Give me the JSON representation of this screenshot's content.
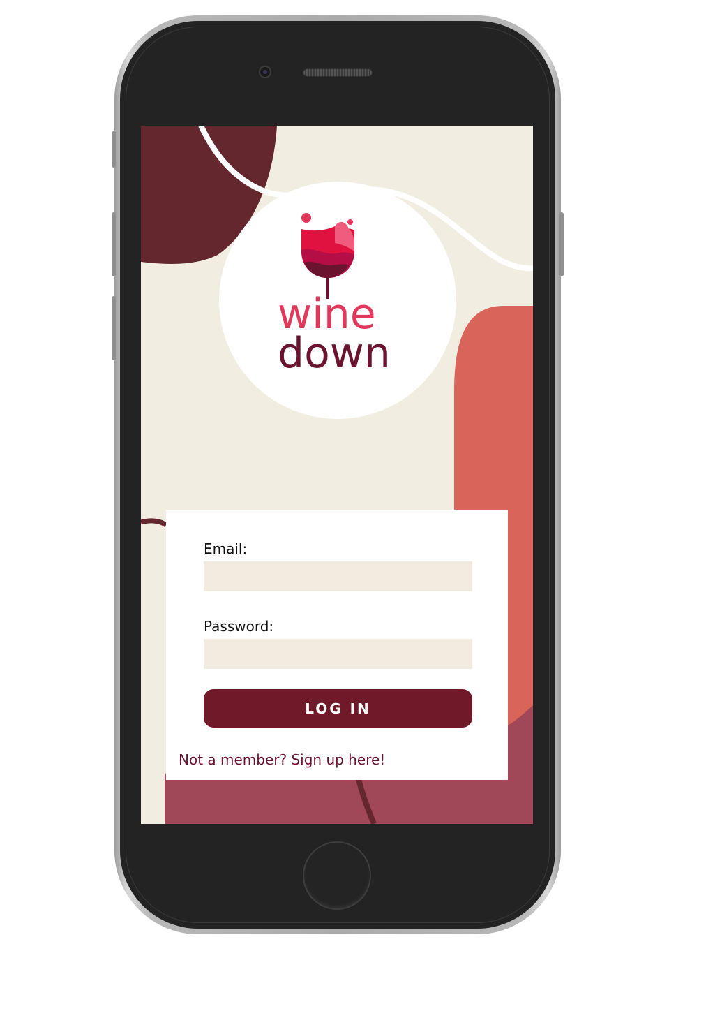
{
  "app": {
    "brand_line1": "wine",
    "brand_line2": "down"
  },
  "login_form": {
    "email_label": "Email:",
    "email_value": "",
    "password_label": "Password:",
    "password_value": "",
    "login_button_label": "LOG IN",
    "signup_link_text": "Not a member? Sign up here!"
  },
  "colors": {
    "background_cream": "#f2ede1",
    "dark_maroon": "#63272d",
    "coral": "#d9655a",
    "mauve": "#a04857",
    "button_maroon": "#701a29",
    "brand_pink": "#e2385c",
    "brand_wine": "#6b1430",
    "input_fill": "#f2ebe0"
  },
  "icons": {
    "logo": "wine-glass-icon",
    "home": "home-button-icon",
    "camera": "front-camera-icon",
    "speaker": "earpiece-speaker-icon"
  }
}
